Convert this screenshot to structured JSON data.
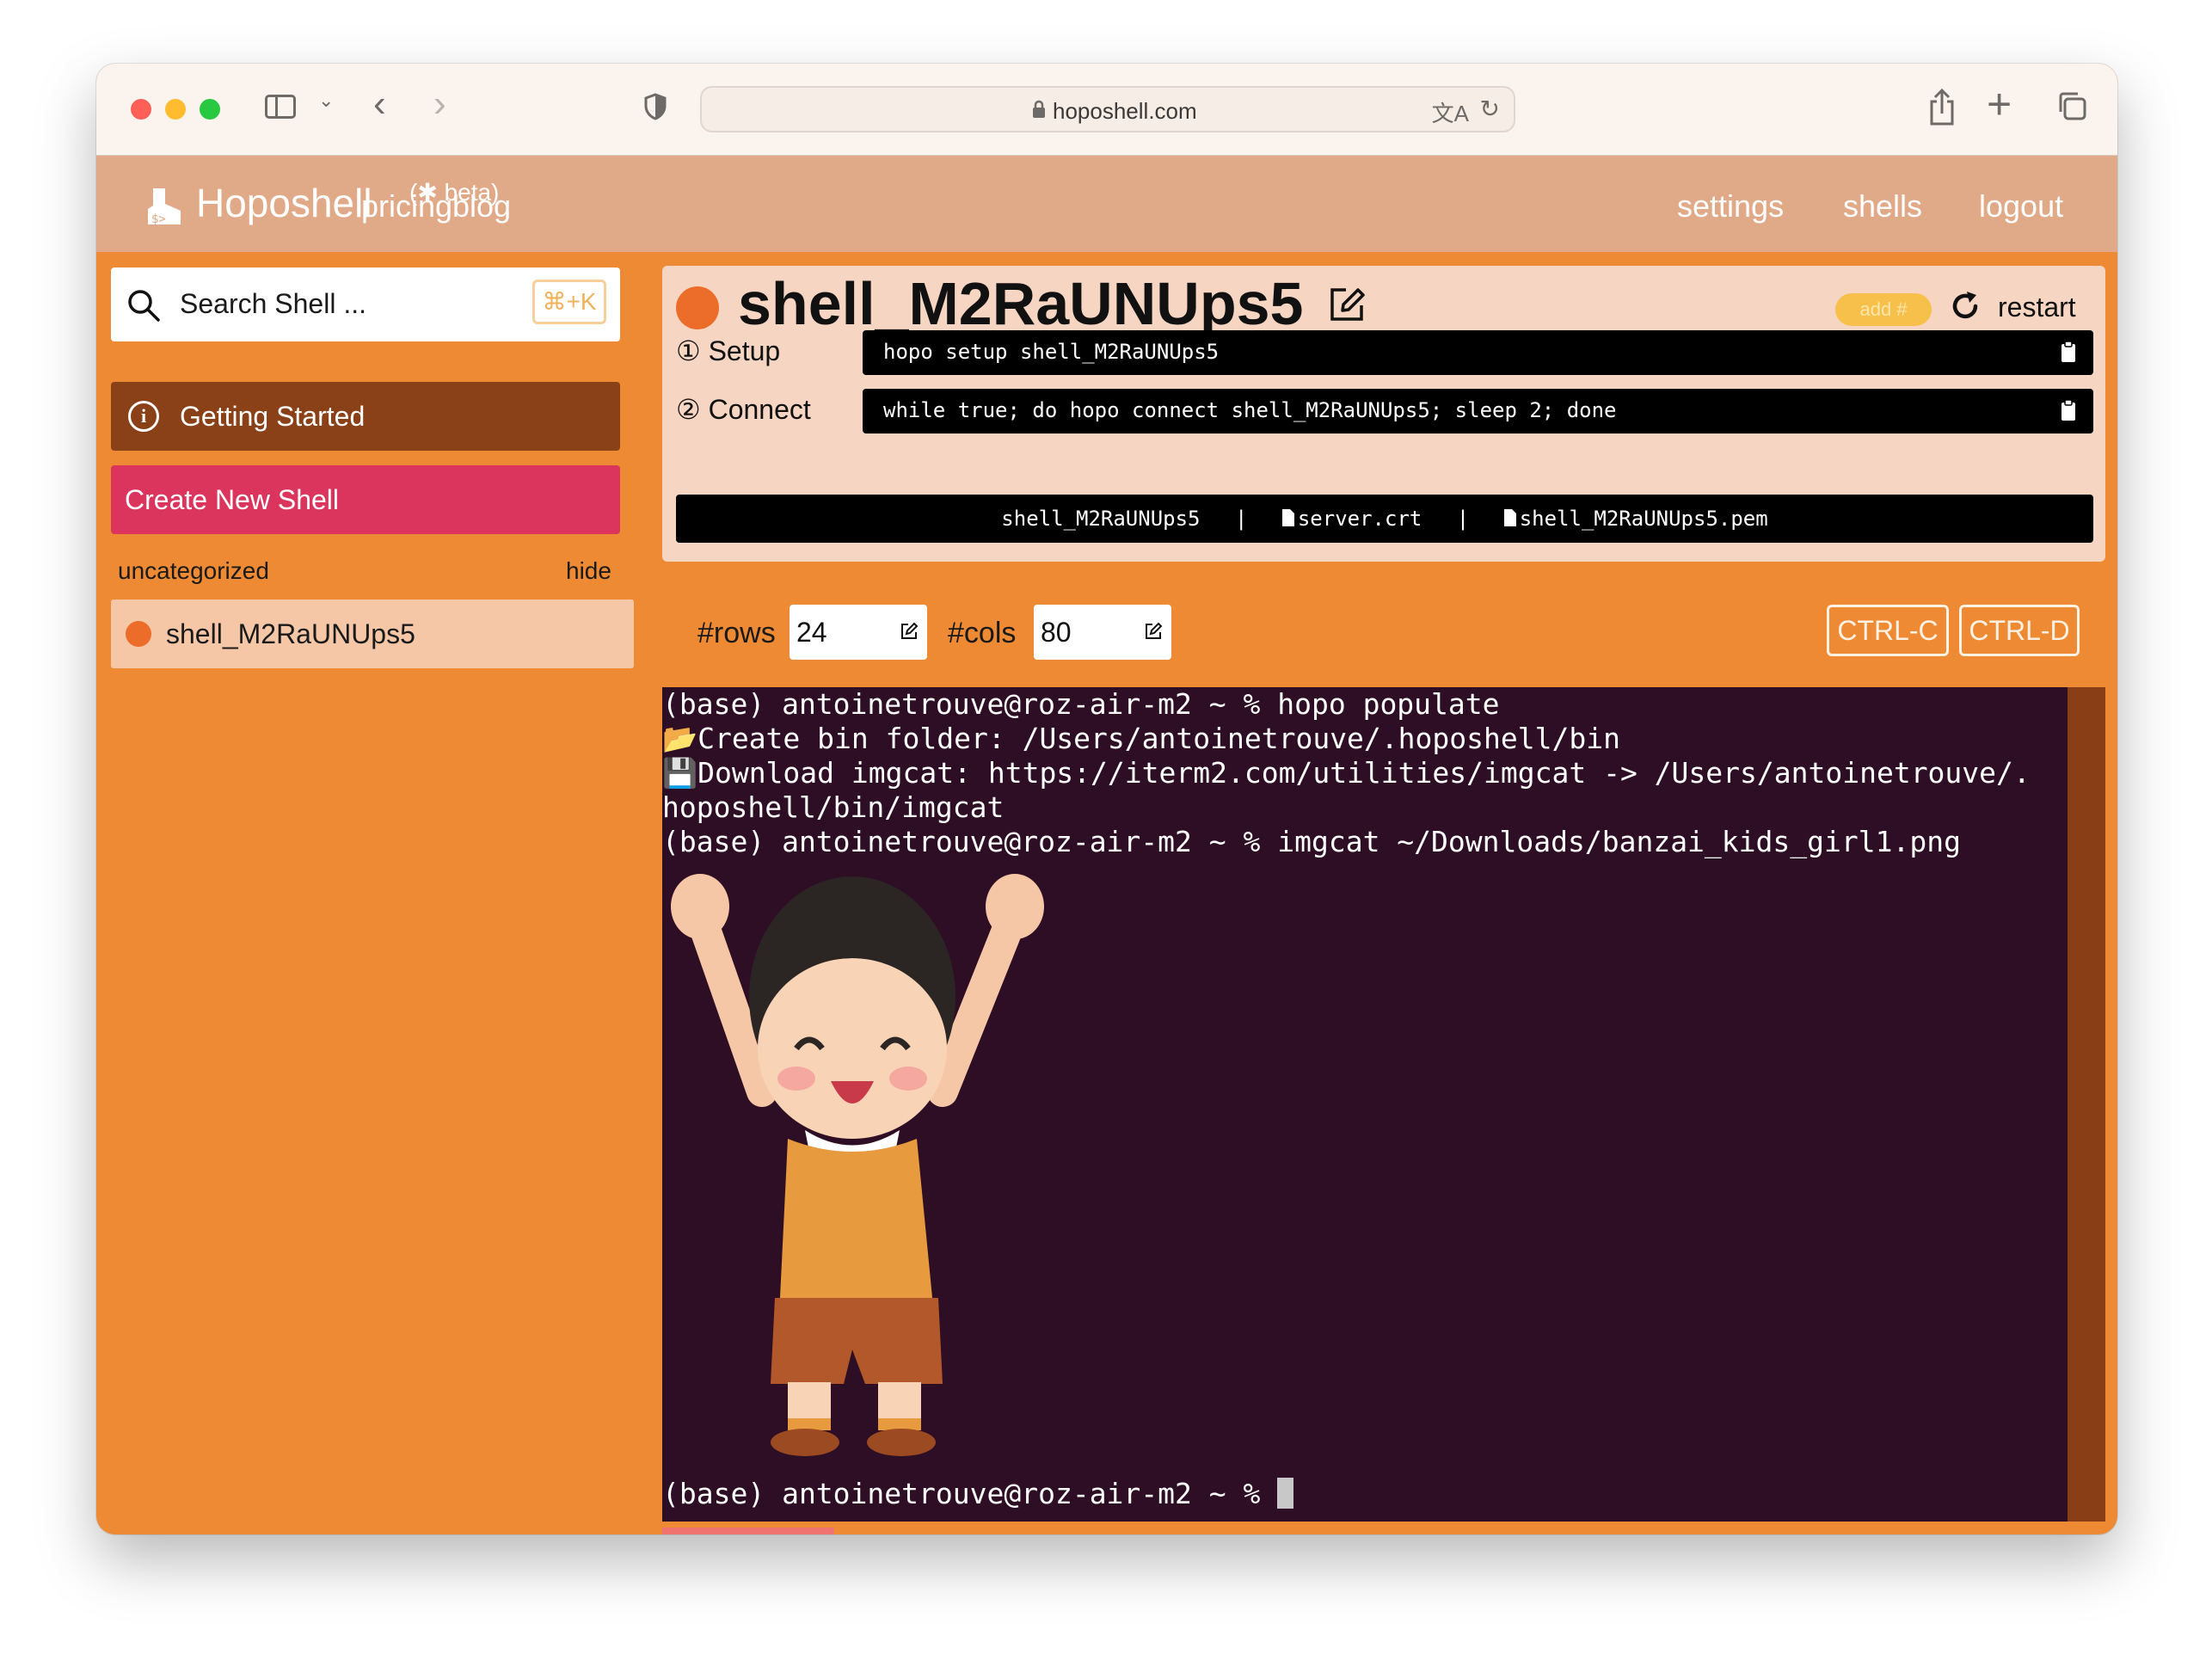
{
  "browser": {
    "url": "hoposhell.com"
  },
  "navbar": {
    "brand": "Hoposhell",
    "beta": "(✱ beta)",
    "links": [
      "pricing",
      "blog",
      "settings",
      "shells",
      "logout"
    ]
  },
  "sidebar": {
    "search_placeholder": "Search Shell ...",
    "search_shortcut": "⌘+K",
    "getting_started": "Getting Started",
    "create_new_shell": "Create New Shell",
    "group_name": "uncategorized",
    "group_hide": "hide",
    "shells": [
      {
        "name": "shell_M2RaUNUps5",
        "status_color": "#ec6c2a"
      }
    ]
  },
  "shell": {
    "name": "shell_M2RaUNUps5",
    "status_color": "#ec6c2a",
    "add_tag": "add #",
    "restart": "restart",
    "setup_label": "① Setup",
    "setup_cmd": "hopo setup shell_M2RaUNUps5",
    "connect_label": "② Connect",
    "connect_cmd": "while true; do hopo connect shell_M2RaUNUps5; sleep 2; done",
    "files": [
      "shell_M2RaUNUps5",
      "server.crt",
      "shell_M2RaUNUps5.pem"
    ],
    "file_sep": "|"
  },
  "controls": {
    "rows_label": "#rows",
    "rows_value": "24",
    "cols_label": "#cols",
    "cols_value": "80",
    "ctrl_c": "CTRL-C",
    "ctrl_d": "CTRL-D"
  },
  "terminal": {
    "lines": [
      "(base) antoinetrouve@roz-air-m2 ~ % hopo populate",
      "📂Create bin folder: /Users/antoinetrouve/.hoposhell/bin",
      "💾Download imgcat: https://iterm2.com/utilities/imgcat -> /Users/antoinetrouve/.",
      "hoposhell/bin/imgcat",
      "(base) antoinetrouve@roz-air-m2 ~ % imgcat ~/Downloads/banzai_kids_girl1.png"
    ],
    "prompt": "(base) antoinetrouve@roz-air-m2 ~ % ",
    "colors": {
      "background": "#2e0e24",
      "scrollbar": "#8a3e16"
    }
  },
  "colors": {
    "page_orange": "#ee8a33",
    "navbar": "#e0a987",
    "getting_started_bg": "#8a4118",
    "create_bg": "#db355d",
    "card_bg": "#f6d5c2"
  },
  "icons": [
    "sidebar-icon",
    "chevron-down-icon",
    "back-icon",
    "forward-icon",
    "shield-icon",
    "lock-icon",
    "translate-icon",
    "reload-icon",
    "share-icon",
    "plus-icon",
    "tabs-icon",
    "logo-icon",
    "search-icon",
    "info-icon",
    "pencil-icon",
    "restart-icon",
    "clipboard-icon",
    "file-icon"
  ]
}
